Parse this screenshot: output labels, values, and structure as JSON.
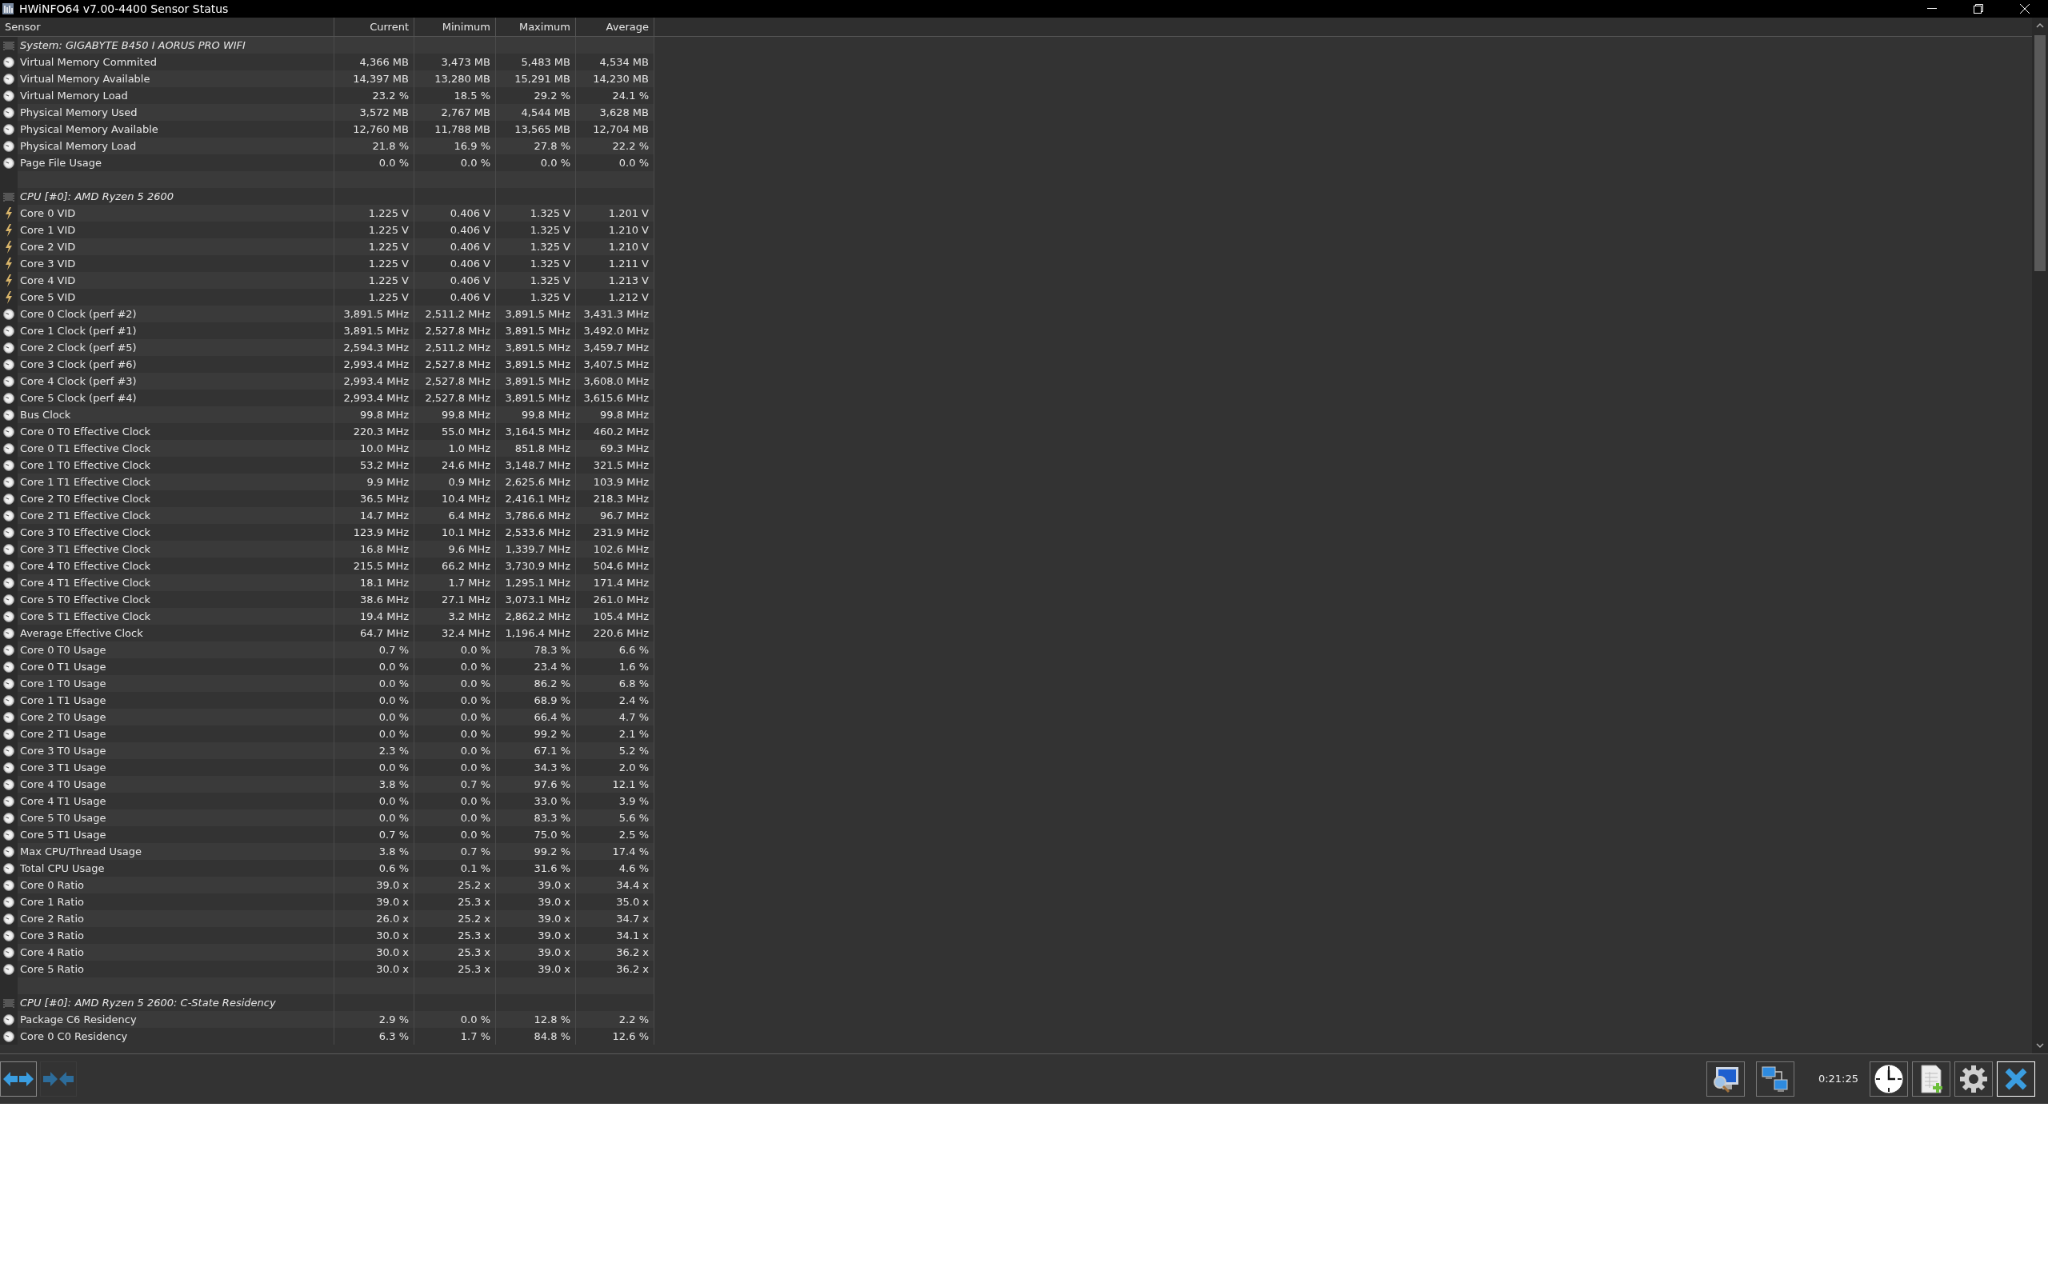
{
  "window": {
    "title": "HWiNFO64 v7.00-4400 Sensor Status"
  },
  "table": {
    "columns": [
      "Sensor",
      "Current",
      "Minimum",
      "Maximum",
      "Average"
    ],
    "rows": [
      {
        "kind": "group",
        "sensor": "System: GIGABYTE B450 I AORUS PRO WIFI"
      },
      {
        "kind": "gauge",
        "sensor": "Virtual Memory Commited",
        "values": [
          "4,366 MB",
          "3,473 MB",
          "5,483 MB",
          "4,534 MB"
        ]
      },
      {
        "kind": "gauge",
        "sensor": "Virtual Memory Available",
        "values": [
          "14,397 MB",
          "13,280 MB",
          "15,291 MB",
          "14,230 MB"
        ]
      },
      {
        "kind": "gauge",
        "sensor": "Virtual Memory Load",
        "values": [
          "23.2 %",
          "18.5 %",
          "29.2 %",
          "24.1 %"
        ]
      },
      {
        "kind": "gauge",
        "sensor": "Physical Memory Used",
        "values": [
          "3,572 MB",
          "2,767 MB",
          "4,544 MB",
          "3,628 MB"
        ]
      },
      {
        "kind": "gauge",
        "sensor": "Physical Memory Available",
        "values": [
          "12,760 MB",
          "11,788 MB",
          "13,565 MB",
          "12,704 MB"
        ]
      },
      {
        "kind": "gauge",
        "sensor": "Physical Memory Load",
        "values": [
          "21.8 %",
          "16.9 %",
          "27.8 %",
          "22.2 %"
        ]
      },
      {
        "kind": "gauge",
        "sensor": "Page File Usage",
        "values": [
          "0.0 %",
          "0.0 %",
          "0.0 %",
          "0.0 %"
        ]
      },
      {
        "kind": "blank"
      },
      {
        "kind": "group",
        "sensor": "CPU [#0]: AMD Ryzen 5 2600"
      },
      {
        "kind": "bolt",
        "sensor": "Core 0 VID",
        "values": [
          "1.225 V",
          "0.406 V",
          "1.325 V",
          "1.201 V"
        ]
      },
      {
        "kind": "bolt",
        "sensor": "Core 1 VID",
        "values": [
          "1.225 V",
          "0.406 V",
          "1.325 V",
          "1.210 V"
        ]
      },
      {
        "kind": "bolt",
        "sensor": "Core 2 VID",
        "values": [
          "1.225 V",
          "0.406 V",
          "1.325 V",
          "1.210 V"
        ]
      },
      {
        "kind": "bolt",
        "sensor": "Core 3 VID",
        "values": [
          "1.225 V",
          "0.406 V",
          "1.325 V",
          "1.211 V"
        ]
      },
      {
        "kind": "bolt",
        "sensor": "Core 4 VID",
        "values": [
          "1.225 V",
          "0.406 V",
          "1.325 V",
          "1.213 V"
        ]
      },
      {
        "kind": "bolt",
        "sensor": "Core 5 VID",
        "values": [
          "1.225 V",
          "0.406 V",
          "1.325 V",
          "1.212 V"
        ]
      },
      {
        "kind": "gauge",
        "sensor": "Core 0 Clock (perf #2)",
        "values": [
          "3,891.5 MHz",
          "2,511.2 MHz",
          "3,891.5 MHz",
          "3,431.3 MHz"
        ]
      },
      {
        "kind": "gauge",
        "sensor": "Core 1 Clock (perf #1)",
        "values": [
          "3,891.5 MHz",
          "2,527.8 MHz",
          "3,891.5 MHz",
          "3,492.0 MHz"
        ]
      },
      {
        "kind": "gauge",
        "sensor": "Core 2 Clock (perf #5)",
        "values": [
          "2,594.3 MHz",
          "2,511.2 MHz",
          "3,891.5 MHz",
          "3,459.7 MHz"
        ]
      },
      {
        "kind": "gauge",
        "sensor": "Core 3 Clock (perf #6)",
        "values": [
          "2,993.4 MHz",
          "2,527.8 MHz",
          "3,891.5 MHz",
          "3,407.5 MHz"
        ]
      },
      {
        "kind": "gauge",
        "sensor": "Core 4 Clock (perf #3)",
        "values": [
          "2,993.4 MHz",
          "2,527.8 MHz",
          "3,891.5 MHz",
          "3,608.0 MHz"
        ]
      },
      {
        "kind": "gauge",
        "sensor": "Core 5 Clock (perf #4)",
        "values": [
          "2,993.4 MHz",
          "2,527.8 MHz",
          "3,891.5 MHz",
          "3,615.6 MHz"
        ]
      },
      {
        "kind": "gauge",
        "sensor": "Bus Clock",
        "values": [
          "99.8 MHz",
          "99.8 MHz",
          "99.8 MHz",
          "99.8 MHz"
        ]
      },
      {
        "kind": "gauge",
        "sensor": "Core 0 T0 Effective Clock",
        "values": [
          "220.3 MHz",
          "55.0 MHz",
          "3,164.5 MHz",
          "460.2 MHz"
        ]
      },
      {
        "kind": "gauge",
        "sensor": "Core 0 T1 Effective Clock",
        "values": [
          "10.0 MHz",
          "1.0 MHz",
          "851.8 MHz",
          "69.3 MHz"
        ]
      },
      {
        "kind": "gauge",
        "sensor": "Core 1 T0 Effective Clock",
        "values": [
          "53.2 MHz",
          "24.6 MHz",
          "3,148.7 MHz",
          "321.5 MHz"
        ]
      },
      {
        "kind": "gauge",
        "sensor": "Core 1 T1 Effective Clock",
        "values": [
          "9.9 MHz",
          "0.9 MHz",
          "2,625.6 MHz",
          "103.9 MHz"
        ]
      },
      {
        "kind": "gauge",
        "sensor": "Core 2 T0 Effective Clock",
        "values": [
          "36.5 MHz",
          "10.4 MHz",
          "2,416.1 MHz",
          "218.3 MHz"
        ]
      },
      {
        "kind": "gauge",
        "sensor": "Core 2 T1 Effective Clock",
        "values": [
          "14.7 MHz",
          "6.4 MHz",
          "3,786.6 MHz",
          "96.7 MHz"
        ]
      },
      {
        "kind": "gauge",
        "sensor": "Core 3 T0 Effective Clock",
        "values": [
          "123.9 MHz",
          "10.1 MHz",
          "2,533.6 MHz",
          "231.9 MHz"
        ]
      },
      {
        "kind": "gauge",
        "sensor": "Core 3 T1 Effective Clock",
        "values": [
          "16.8 MHz",
          "9.6 MHz",
          "1,339.7 MHz",
          "102.6 MHz"
        ]
      },
      {
        "kind": "gauge",
        "sensor": "Core 4 T0 Effective Clock",
        "values": [
          "215.5 MHz",
          "66.2 MHz",
          "3,730.9 MHz",
          "504.6 MHz"
        ]
      },
      {
        "kind": "gauge",
        "sensor": "Core 4 T1 Effective Clock",
        "values": [
          "18.1 MHz",
          "1.7 MHz",
          "1,295.1 MHz",
          "171.4 MHz"
        ]
      },
      {
        "kind": "gauge",
        "sensor": "Core 5 T0 Effective Clock",
        "values": [
          "38.6 MHz",
          "27.1 MHz",
          "3,073.1 MHz",
          "261.0 MHz"
        ]
      },
      {
        "kind": "gauge",
        "sensor": "Core 5 T1 Effective Clock",
        "values": [
          "19.4 MHz",
          "3.2 MHz",
          "2,862.2 MHz",
          "105.4 MHz"
        ]
      },
      {
        "kind": "gauge",
        "sensor": "Average Effective Clock",
        "values": [
          "64.7 MHz",
          "32.4 MHz",
          "1,196.4 MHz",
          "220.6 MHz"
        ]
      },
      {
        "kind": "gauge",
        "sensor": "Core 0 T0 Usage",
        "values": [
          "0.7 %",
          "0.0 %",
          "78.3 %",
          "6.6 %"
        ]
      },
      {
        "kind": "gauge",
        "sensor": "Core 0 T1 Usage",
        "values": [
          "0.0 %",
          "0.0 %",
          "23.4 %",
          "1.6 %"
        ]
      },
      {
        "kind": "gauge",
        "sensor": "Core 1 T0 Usage",
        "values": [
          "0.0 %",
          "0.0 %",
          "86.2 %",
          "6.8 %"
        ]
      },
      {
        "kind": "gauge",
        "sensor": "Core 1 T1 Usage",
        "values": [
          "0.0 %",
          "0.0 %",
          "68.9 %",
          "2.4 %"
        ]
      },
      {
        "kind": "gauge",
        "sensor": "Core 2 T0 Usage",
        "values": [
          "0.0 %",
          "0.0 %",
          "66.4 %",
          "4.7 %"
        ]
      },
      {
        "kind": "gauge",
        "sensor": "Core 2 T1 Usage",
        "values": [
          "0.0 %",
          "0.0 %",
          "99.2 %",
          "2.1 %"
        ]
      },
      {
        "kind": "gauge",
        "sensor": "Core 3 T0 Usage",
        "values": [
          "2.3 %",
          "0.0 %",
          "67.1 %",
          "5.2 %"
        ]
      },
      {
        "kind": "gauge",
        "sensor": "Core 3 T1 Usage",
        "values": [
          "0.0 %",
          "0.0 %",
          "34.3 %",
          "2.0 %"
        ]
      },
      {
        "kind": "gauge",
        "sensor": "Core 4 T0 Usage",
        "values": [
          "3.8 %",
          "0.7 %",
          "97.6 %",
          "12.1 %"
        ]
      },
      {
        "kind": "gauge",
        "sensor": "Core 4 T1 Usage",
        "values": [
          "0.0 %",
          "0.0 %",
          "33.0 %",
          "3.9 %"
        ]
      },
      {
        "kind": "gauge",
        "sensor": "Core 5 T0 Usage",
        "values": [
          "0.0 %",
          "0.0 %",
          "83.3 %",
          "5.6 %"
        ]
      },
      {
        "kind": "gauge",
        "sensor": "Core 5 T1 Usage",
        "values": [
          "0.7 %",
          "0.0 %",
          "75.0 %",
          "2.5 %"
        ]
      },
      {
        "kind": "gauge",
        "sensor": "Max CPU/Thread Usage",
        "values": [
          "3.8 %",
          "0.7 %",
          "99.2 %",
          "17.4 %"
        ]
      },
      {
        "kind": "gauge",
        "sensor": "Total CPU Usage",
        "values": [
          "0.6 %",
          "0.1 %",
          "31.6 %",
          "4.6 %"
        ]
      },
      {
        "kind": "gauge",
        "sensor": "Core 0 Ratio",
        "values": [
          "39.0 x",
          "25.2 x",
          "39.0 x",
          "34.4 x"
        ]
      },
      {
        "kind": "gauge",
        "sensor": "Core 1 Ratio",
        "values": [
          "39.0 x",
          "25.3 x",
          "39.0 x",
          "35.0 x"
        ]
      },
      {
        "kind": "gauge",
        "sensor": "Core 2 Ratio",
        "values": [
          "26.0 x",
          "25.2 x",
          "39.0 x",
          "34.7 x"
        ]
      },
      {
        "kind": "gauge",
        "sensor": "Core 3 Ratio",
        "values": [
          "30.0 x",
          "25.3 x",
          "39.0 x",
          "34.1 x"
        ]
      },
      {
        "kind": "gauge",
        "sensor": "Core 4 Ratio",
        "values": [
          "30.0 x",
          "25.3 x",
          "39.0 x",
          "36.2 x"
        ]
      },
      {
        "kind": "gauge",
        "sensor": "Core 5 Ratio",
        "values": [
          "30.0 x",
          "25.3 x",
          "39.0 x",
          "36.2 x"
        ]
      },
      {
        "kind": "blank"
      },
      {
        "kind": "group",
        "sensor": "CPU [#0]: AMD Ryzen 5 2600: C-State Residency"
      },
      {
        "kind": "gauge",
        "sensor": "Package C6 Residency",
        "values": [
          "2.9 %",
          "0.0 %",
          "12.8 %",
          "2.2 %"
        ]
      },
      {
        "kind": "gauge",
        "sensor": "Core 0 C0 Residency",
        "values": [
          "6.3 %",
          "1.7 %",
          "84.8 %",
          "12.6 %"
        ]
      }
    ]
  },
  "toolbar": {
    "elapsed": "0:21:25"
  }
}
